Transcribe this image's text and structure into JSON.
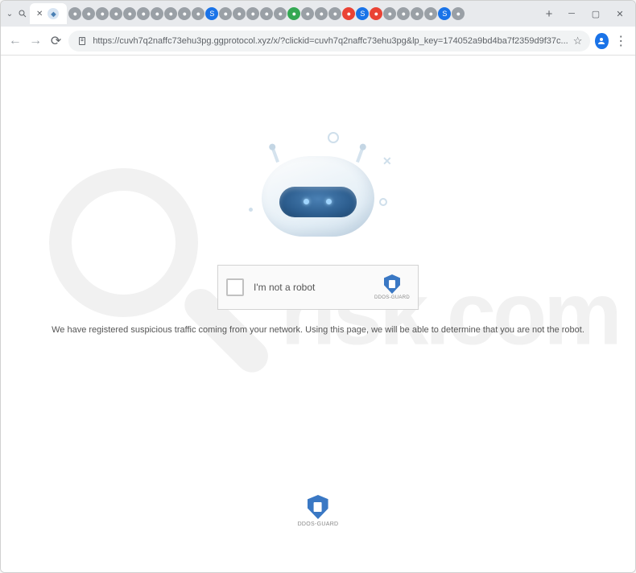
{
  "tab_strip": {
    "active_tab_title": "",
    "new_tab_label": "+"
  },
  "toolbar": {
    "url": "https://cuvh7q2naffc73ehu3pg.ggprotocol.xyz/x/?clickid=cuvh7q2naffc73ehu3pg&lp_key=174052a9bd4ba7f2359d9f37c..."
  },
  "page": {
    "captcha_label": "I'm not a robot",
    "brand_name": "DDOS-GUARD",
    "message": "We have registered suspicious traffic coming from your network. Using this page, we will be able to determine that you are not the robot."
  },
  "watermark": {
    "text": "risk.com"
  },
  "colors": {
    "brand_shield": "#3a78c4",
    "visor": "#2d5e8f"
  }
}
